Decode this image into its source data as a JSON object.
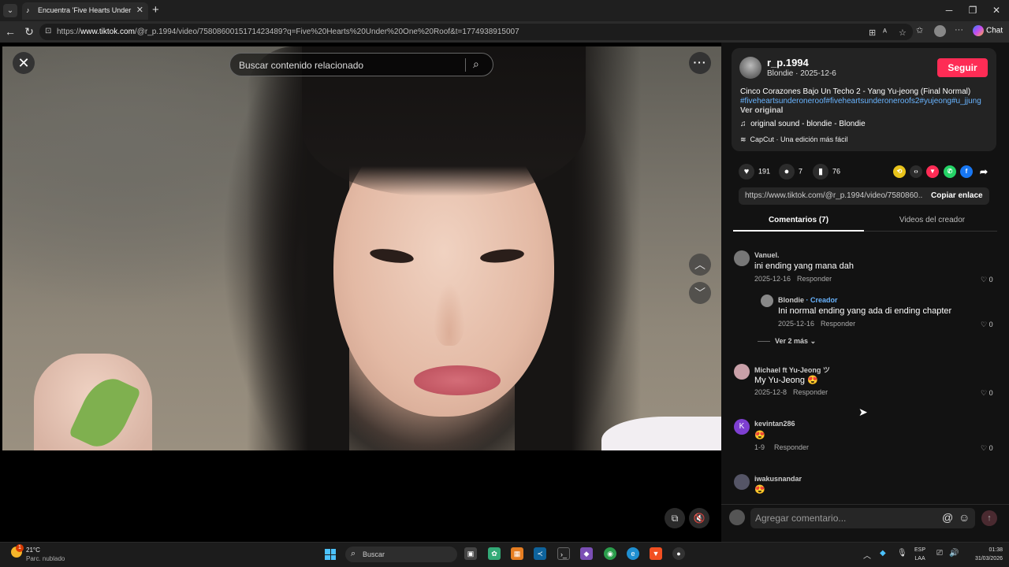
{
  "browser": {
    "tab_title": "Encuentra 'Five Hearts Under One",
    "url_prefix": "https://",
    "url_domain": "www.tiktok.com",
    "url_rest": "/@r_p.1994/video/7580860015171423489?q=Five%20Hearts%20Under%20One%20Roof&t=1774938915007",
    "chat_label": "Chat"
  },
  "player": {
    "search_placeholder": "Buscar contenido relacionado"
  },
  "post": {
    "username": "r_p.1994",
    "subline": "Blondie · 2025-12-6",
    "follow_label": "Seguir",
    "description": "Cinco Corazones Bajo Un Techo 2 - Yang Yu-jeong (Final Normal)",
    "hashtags": "#fiveheartsunderoneroof#fiveheartsunderoneroofs2#yujeong#u_jjung",
    "ver_original": "Ver original",
    "sound": "original sound - blondie - Blondie",
    "capcut": "CapCut · Una edición más fácil",
    "likes": "191",
    "comments_count": "7",
    "saves": "76",
    "share_link": "https://www.tiktok.com/@r_p.1994/video/7580860...",
    "copy_link_label": "Copiar enlace"
  },
  "tabs": {
    "comments": "Comentarios (7)",
    "creator_videos": "Videos del creador"
  },
  "comments": [
    {
      "name": "Vanuel.",
      "text": "ini ending yang mana dah",
      "date": "2025-12-16",
      "reply": "Responder",
      "likes": "0"
    },
    {
      "name": "Blondie",
      "creator_tag": "· Creador",
      "text": "Ini normal ending yang ada di ending chapter",
      "date": "2025-12-16",
      "reply": "Responder",
      "likes": "0"
    },
    {
      "name": "Michael ft Yu-Jeong ツ",
      "text": "My Yu-Jeong 😍",
      "date": "2025-12-8",
      "reply": "Responder",
      "likes": "0"
    },
    {
      "name": "kevintan286",
      "text": "😍",
      "date": "1-9",
      "reply": "Responder",
      "likes": "0"
    },
    {
      "name": "iwakusnandar",
      "text": "😍"
    }
  ],
  "more_replies": "Ver 2 más",
  "comment_input": {
    "placeholder": "Agregar comentario..."
  },
  "taskbar": {
    "temp": "21°C",
    "weather_desc": "Parc. nublado",
    "weather_badge": "1",
    "search_placeholder": "Buscar",
    "lang_top": "ESP",
    "lang_bottom": "LAA",
    "time": "01:38",
    "date": "31/03/2026"
  },
  "colors": {
    "follow": "#fe2c55",
    "hashtag": "#69b4ff",
    "panel_bg": "#121212"
  }
}
